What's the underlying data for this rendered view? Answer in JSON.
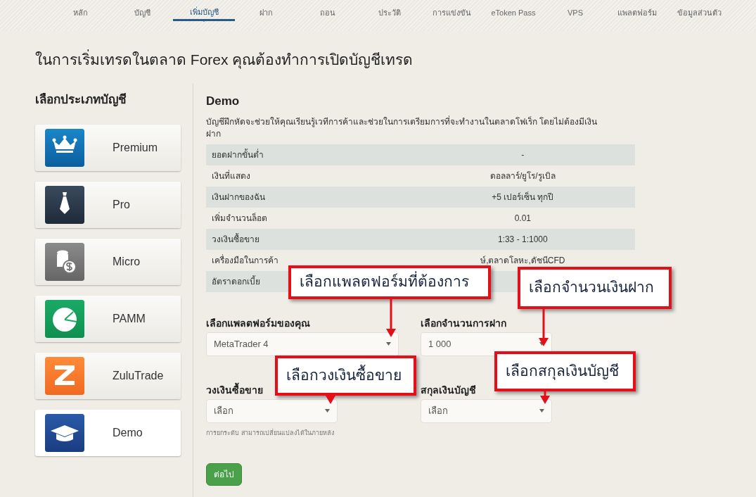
{
  "nav": [
    {
      "label": "หลัก",
      "selected": false
    },
    {
      "label": "บัญชี",
      "selected": false
    },
    {
      "label": "เพิ่มบัญชี",
      "selected": true
    },
    {
      "label": "ฝาก",
      "selected": false
    },
    {
      "label": "ถอน",
      "selected": false
    },
    {
      "label": "ประวัติ",
      "selected": false
    },
    {
      "label": "การแข่งขัน",
      "selected": false
    },
    {
      "label": "eToken Pass",
      "selected": false
    },
    {
      "label": "VPS",
      "selected": false
    },
    {
      "label": "แพลตฟอร์ม",
      "selected": false
    },
    {
      "label": "ข้อมูลส่วนตัว",
      "selected": false
    }
  ],
  "heading": "ในการเริ่มเทรดในตลาด Forex คุณต้องทำการเปิดบัญชีเทรด",
  "sidebar": {
    "title": "เลือกประเภทบัญชี",
    "items": [
      {
        "label": "Premium",
        "selected": false
      },
      {
        "label": "Pro",
        "selected": false
      },
      {
        "label": "Micro",
        "selected": false
      },
      {
        "label": "PAMM",
        "selected": false
      },
      {
        "label": "ZuluTrade",
        "selected": false
      },
      {
        "label": "Demo",
        "selected": true
      }
    ]
  },
  "account": {
    "title": "Demo",
    "description": "บัญชีฝึกหัดจะช่วยให้คุณเรียนรู้เวทีการค้าและช่วยในการเตรียมการที่จะทำงานในตลาดโฟเร็ก โดยไม่ต้องมีเงินฝาก",
    "rows": [
      {
        "label": "ยอดฝากขั้นต่ำ",
        "value": "-"
      },
      {
        "label": "เงินที่แสดง",
        "value": "ดอลลาร์/ยูโร/รูเบิล"
      },
      {
        "label": "เงินฝากของฉัน",
        "value": "+5 เปอร์เซ็น ทุกปี"
      },
      {
        "label": "เพิ่มจำนวนล็อต",
        "value": "0.01"
      },
      {
        "label": "วงเงินซื้อขาย",
        "value": "1:33 - 1:1000"
      },
      {
        "label": "เครื่องมือในการค้า",
        "value": "ษ์,ตลาดโลหะ,ดัชนีCFD"
      },
      {
        "label": "อัตราดอกเบี้ย"
      }
    ]
  },
  "form": {
    "fields": [
      {
        "label": "เลือกแพลตฟอร์มของคุณ",
        "value": "MetaTrader 4"
      },
      {
        "label": "เลือกจำนวนการฝาก",
        "value": "1 000"
      },
      {
        "label": "วงเงินซื้อขาย",
        "value": "เลือก"
      },
      {
        "label": "สกุลเงินบัญชี",
        "value": "เลือก"
      }
    ],
    "hint": "การยกระดับ สามารถเปลี่ยนแปลงได้ในภายหลัง",
    "submit": "ต่อไป"
  },
  "callouts": [
    "เลือกแพลตฟอร์มที่ต้องการ",
    "เลือกจำนวนเงินฝาก",
    "เลือกวงเงินซื้อขาย",
    "เลือกสกุลเงินบัญชี"
  ]
}
